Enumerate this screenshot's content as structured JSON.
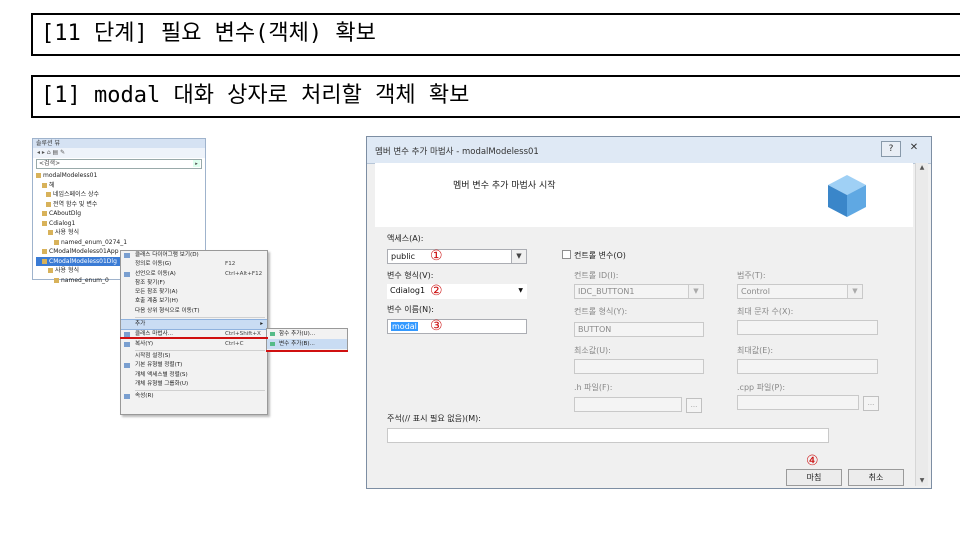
{
  "slide": {
    "heading": "[11 단계] 필요 변수(객체) 확보",
    "subheading": "[1] modal 대화 상자로 처리할 객체 확보"
  },
  "solution_explorer": {
    "title": "솔루션 뷰",
    "search": "<검색>",
    "tree": [
      "modalModeless01",
      "헤",
      "네임스페이스 상수",
      "전역 함수 및 변수",
      "CAboutDlg",
      "Cdialog1",
      "사용 형식",
      "named_enum_0274_1",
      "CModalModeless01App",
      "CModalModeless01Dlg",
      "사용 형식",
      "named_enum_0"
    ]
  },
  "context_menu": {
    "items": [
      {
        "label": "클래스 다이어그램 보기(D)",
        "shortcut": ""
      },
      {
        "label": "정의로 이동(G)",
        "shortcut": "F12"
      },
      {
        "label": "선언으로 이동(A)",
        "shortcut": "Ctrl+Alt+F12"
      },
      {
        "label": "참조 찾기(F)",
        "shortcut": ""
      },
      {
        "label": "모든 참조 찾기(A)",
        "shortcut": ""
      },
      {
        "label": "호출 계층 보기(H)",
        "shortcut": ""
      },
      {
        "label": "다음 상위 형식으로 이동(T)",
        "shortcut": ""
      },
      {
        "label": "추가",
        "shortcut": ""
      },
      {
        "label": "클래스 마법사...",
        "shortcut": "Ctrl+Shift+X"
      },
      {
        "label": "복사(Y)",
        "shortcut": "Ctrl+C"
      },
      {
        "label": "시작점 설정(S)",
        "shortcut": ""
      },
      {
        "label": "기본 유형별 정렬(T)",
        "shortcut": ""
      },
      {
        "label": "개체 액세스별 정렬(S)",
        "shortcut": ""
      },
      {
        "label": "개체 유형별 그룹화(U)",
        "shortcut": ""
      },
      {
        "label": "속성(R)",
        "shortcut": ""
      }
    ],
    "submenu": [
      "함수 추가(U)...",
      "변수 추가(B)..."
    ]
  },
  "dialog": {
    "title": "멤버 변수 추가 마법사 - modalModeless01",
    "help_label": "?",
    "close_label": "✕",
    "header_text": "멤버 변수 추가 마법사 시작",
    "access_label": "액세스(A):",
    "access_value": "public",
    "control_var_label": "컨트롤 변수(O)",
    "var_type_label": "변수 형식(V):",
    "var_type_value": "Cdialog1",
    "var_name_label": "변수 이름(N):",
    "var_name_value": "modal",
    "control_id_label": "컨트롤 ID(I):",
    "control_id_value": "IDC_BUTTON1",
    "category_label": "범주(T):",
    "category_value": "Control",
    "control_type_label": "컨트롤 형식(Y):",
    "control_type_value": "BUTTON",
    "max_chars_label": "최대 문자 수(X):",
    "min_value_label": "최소값(U):",
    "max_value_label": "최대값(E):",
    "h_file_label": ".h 파일(F):",
    "cpp_file_label": ".cpp 파일(P):",
    "browse_label": "...",
    "comment_label": "주석(// 표시 필요 없음)(M):",
    "finish_button": "마침",
    "cancel_button": "취소"
  },
  "markers": [
    "①",
    "②",
    "③",
    "④"
  ],
  "colors": {
    "marker": "#cc1111",
    "selection": "#3399ff"
  }
}
